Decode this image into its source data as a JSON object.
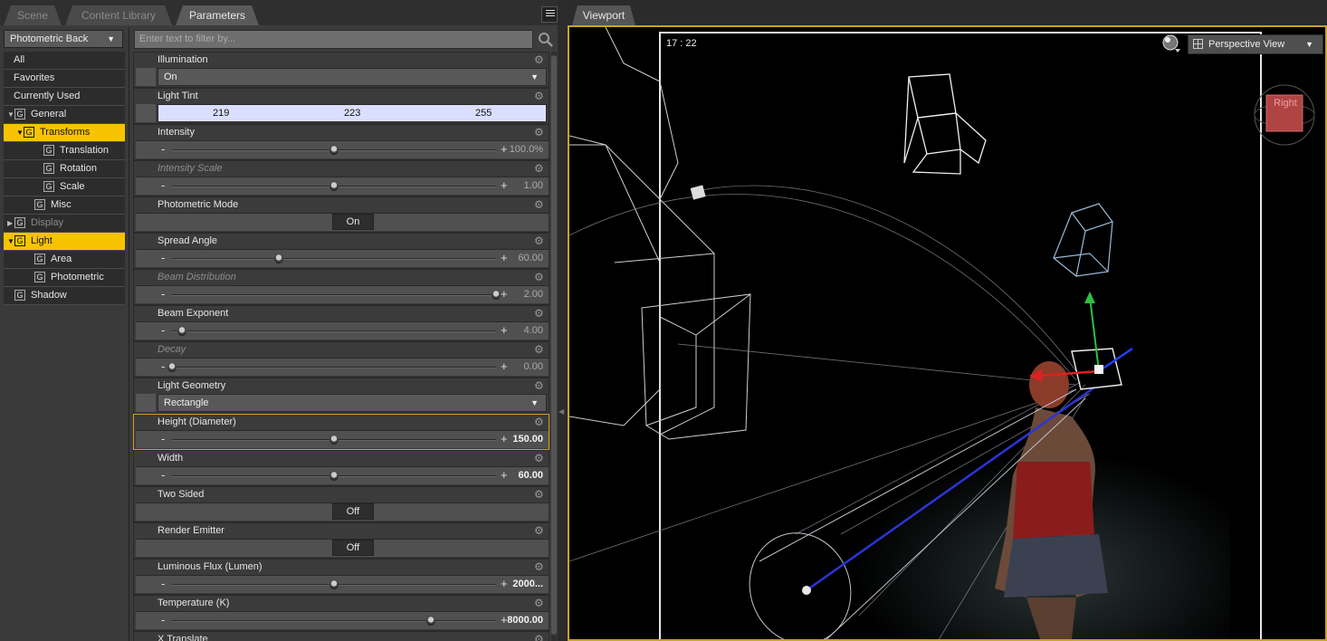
{
  "tabs": [
    {
      "label": "Scene",
      "active": false
    },
    {
      "label": "Content Library",
      "active": false
    },
    {
      "label": "Parameters",
      "active": true
    }
  ],
  "preset": {
    "label": "Photometric Back"
  },
  "nav": {
    "items": [
      {
        "label": "All",
        "level": 0,
        "icon": "",
        "arrow": "",
        "selected": false,
        "dim": false
      },
      {
        "label": "Favorites",
        "level": 0,
        "icon": "",
        "arrow": "",
        "selected": false,
        "dim": false
      },
      {
        "label": "Currently Used",
        "level": 0,
        "icon": "",
        "arrow": "",
        "selected": false,
        "dim": false
      },
      {
        "label": "General",
        "level": 0,
        "icon": "G",
        "arrow": "▼",
        "selected": false,
        "dim": false
      },
      {
        "label": "Transforms",
        "level": 1,
        "icon": "G",
        "arrow": "▼",
        "selected": true,
        "dim": false
      },
      {
        "label": "Translation",
        "level": 2,
        "icon": "G",
        "arrow": "",
        "selected": false,
        "dim": false
      },
      {
        "label": "Rotation",
        "level": 2,
        "icon": "G",
        "arrow": "",
        "selected": false,
        "dim": false
      },
      {
        "label": "Scale",
        "level": 2,
        "icon": "G",
        "arrow": "",
        "selected": false,
        "dim": false
      },
      {
        "label": "Misc",
        "level": 1,
        "icon": "G",
        "arrow": "",
        "selected": false,
        "dim": false
      },
      {
        "label": "Display",
        "level": 0,
        "icon": "G",
        "arrow": "▶",
        "selected": false,
        "dim": true
      },
      {
        "label": "Light",
        "level": 0,
        "icon": "G",
        "arrow": "▼",
        "selected": true,
        "dim": false
      },
      {
        "label": "Area",
        "level": 1,
        "icon": "G",
        "arrow": "",
        "selected": false,
        "dim": false
      },
      {
        "label": "Photometric",
        "level": 1,
        "icon": "G",
        "arrow": "",
        "selected": false,
        "dim": false
      },
      {
        "label": "Shadow",
        "level": 0,
        "icon": "G",
        "arrow": "",
        "selected": false,
        "dim": false
      }
    ]
  },
  "filter": {
    "placeholder": "Enter text to filter by..."
  },
  "params": [
    {
      "name": "Illumination",
      "type": "dropdown",
      "value": "On"
    },
    {
      "name": "Light Tint",
      "type": "color",
      "r": "219",
      "g": "223",
      "b": "255"
    },
    {
      "name": "Intensity",
      "type": "slider",
      "pos": 0.5,
      "value": "100.0%"
    },
    {
      "name": "Intensity Scale",
      "type": "slider",
      "pos": 0.5,
      "value": "1.00",
      "dim": true
    },
    {
      "name": "Photometric Mode",
      "type": "toggle",
      "value": "On"
    },
    {
      "name": "Spread Angle",
      "type": "slider",
      "pos": 0.33,
      "value": "60.00"
    },
    {
      "name": "Beam Distribution",
      "type": "slider",
      "pos": 1.0,
      "value": "2.00",
      "dim": true
    },
    {
      "name": "Beam Exponent",
      "type": "slider",
      "pos": 0.03,
      "value": "4.00"
    },
    {
      "name": "Decay",
      "type": "slider",
      "pos": 0.0,
      "value": "0.00",
      "dim": true
    },
    {
      "name": "Light Geometry",
      "type": "dropdown",
      "value": "Rectangle"
    },
    {
      "name": "Height (Diameter)",
      "type": "slider",
      "pos": 0.5,
      "value": "150.00",
      "selected": true
    },
    {
      "name": "Width",
      "type": "slider",
      "pos": 0.5,
      "value": "60.00",
      "bold": true
    },
    {
      "name": "Two Sided",
      "type": "toggle",
      "value": "Off"
    },
    {
      "name": "Render Emitter",
      "type": "toggle",
      "value": "Off"
    },
    {
      "name": "Luminous Flux (Lumen)",
      "type": "slider",
      "pos": 0.5,
      "value": "2000...",
      "bold": true
    },
    {
      "name": "Temperature (K)",
      "type": "slider",
      "pos": 0.8,
      "value": "8000.00",
      "bold": true
    },
    {
      "name": "X Translate",
      "type": "slider",
      "pos": 0.5,
      "value": ""
    }
  ],
  "viewport": {
    "tab_label": "Viewport",
    "timecode": "17 : 22",
    "view_label": "Perspective View",
    "cube_label": "Right"
  },
  "colors": {
    "accent": "#f7c300",
    "selection_border": "#c9a227",
    "tint": "#dbdfff"
  }
}
